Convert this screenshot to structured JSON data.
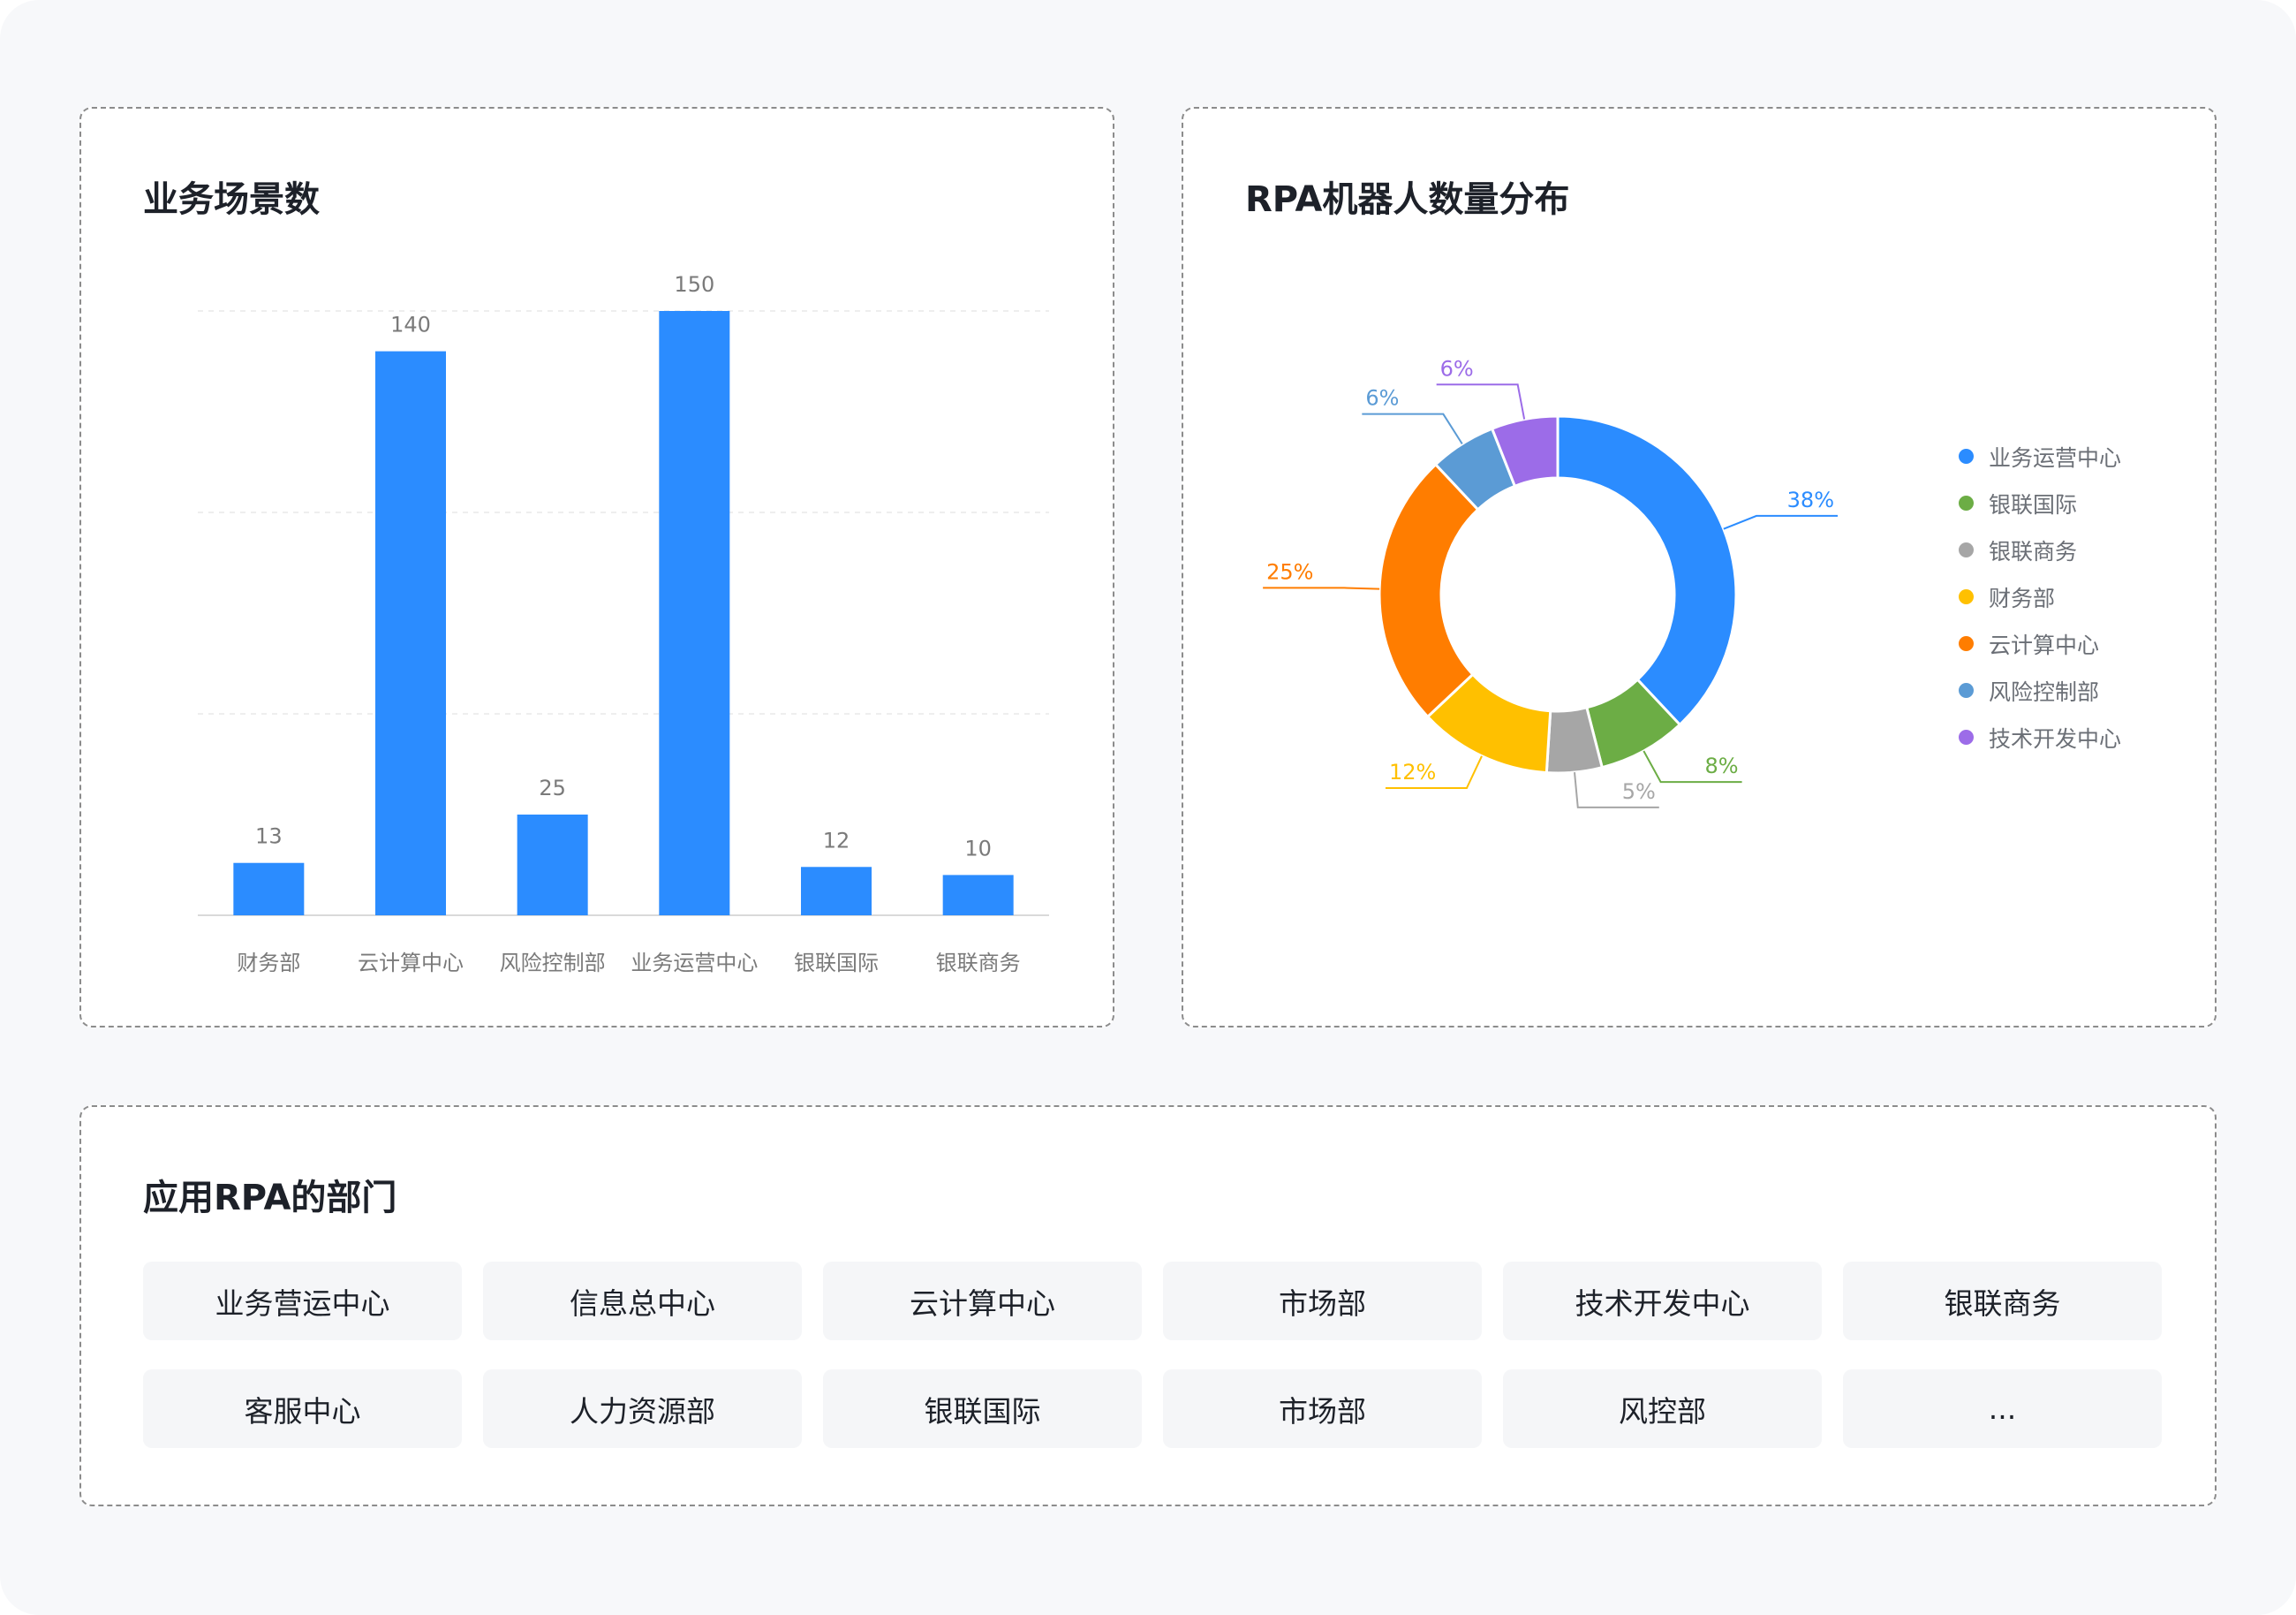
{
  "bar_card": {
    "title": "业务场景数"
  },
  "pie_card": {
    "title": "RPA机器人数量分布",
    "legend": [
      {
        "label": "业务运营中心",
        "color": "#2b8cff"
      },
      {
        "label": "银联国际",
        "color": "#6cad45"
      },
      {
        "label": "银联商务",
        "color": "#a6a6a6"
      },
      {
        "label": "财务部",
        "color": "#ffc000"
      },
      {
        "label": "云计算中心",
        "color": "#ff7d00"
      },
      {
        "label": "风险控制部",
        "color": "#5b9bd5"
      },
      {
        "label": "技术开发中心",
        "color": "#9c6ce8"
      }
    ]
  },
  "dept_card": {
    "title": "应用RPA的部门",
    "items": [
      "业务营运中心",
      "信息总中心",
      "云计算中心",
      "市场部",
      "技术开发中心",
      "银联商务",
      "客服中心",
      "人力资源部",
      "银联国际",
      "市场部",
      "风控部",
      "..."
    ]
  },
  "chart_data": [
    {
      "type": "bar",
      "title": "业务场景数",
      "categories": [
        "财务部",
        "云计算中心",
        "风险控制部",
        "业务运营中心",
        "银联国际",
        "银联商务"
      ],
      "values": [
        13,
        140,
        25,
        150,
        12,
        10
      ],
      "ylim": [
        0,
        150
      ],
      "grid": true,
      "color": "#2b8cff"
    },
    {
      "type": "pie",
      "title": "RPA机器人数量分布",
      "donut": true,
      "legend_position": "right",
      "labels": [
        "业务运营中心",
        "银联国际",
        "银联商务",
        "财务部",
        "云计算中心",
        "风险控制部",
        "技术开发中心"
      ],
      "values": [
        38,
        8,
        5,
        12,
        25,
        6,
        6
      ],
      "value_labels": [
        "38%",
        "8%",
        "5%",
        "12%",
        "25%",
        "6%",
        "6%"
      ],
      "colors": [
        "#2b8cff",
        "#6cad45",
        "#a6a6a6",
        "#ffc000",
        "#ff7d00",
        "#5b9bd5",
        "#9c6ce8"
      ]
    }
  ]
}
